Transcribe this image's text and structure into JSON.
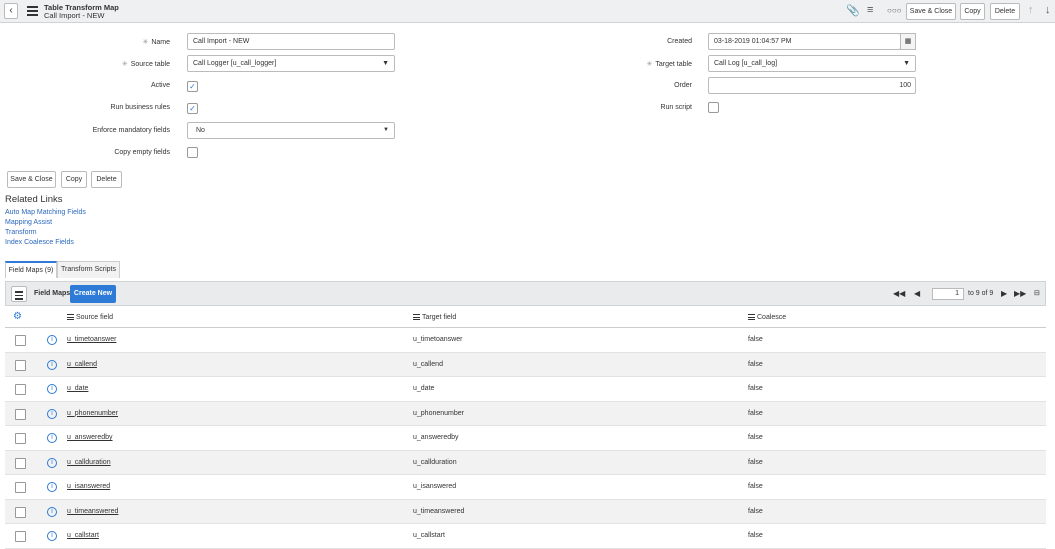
{
  "header": {
    "title": "Table Transform Map",
    "subtitle": "Call Import - NEW",
    "back_glyph": "‹",
    "buttons": {
      "save_close": "Save & Close",
      "copy": "Copy",
      "delete": "Delete"
    }
  },
  "form": {
    "name_label": "Name",
    "name_value": "Call Import - NEW",
    "source_table_label": "Source table",
    "source_table_value": "Call Logger [u_call_logger]",
    "active_label": "Active",
    "run_business_rules_label": "Run business rules",
    "enforce_label": "Enforce mandatory fields",
    "enforce_value": "No",
    "copy_empty_label": "Copy empty fields",
    "created_label": "Created",
    "created_value": "03-18-2019 01:04:57 PM",
    "target_table_label": "Target table",
    "target_table_value": "Call Log [u_call_log]",
    "order_label": "Order",
    "order_value": "100",
    "run_script_label": "Run script",
    "buttons": {
      "save_close": "Save & Close",
      "copy": "Copy",
      "delete": "Delete"
    }
  },
  "related_links": {
    "title": "Related Links",
    "links": [
      "Auto Map Matching Fields",
      "Mapping Assist",
      "Transform",
      "Index Coalesce Fields"
    ]
  },
  "tabs": [
    "Field Maps (9)",
    "Transform Scripts"
  ],
  "list": {
    "title": "Field Maps",
    "create_new": "Create New",
    "page_value": "1",
    "page_total": "to 9 of 9",
    "columns": [
      "Source field",
      "Target field",
      "Coalesce"
    ],
    "rows": [
      [
        "u_timetoanswer",
        "u_timetoanswer",
        "false"
      ],
      [
        "u_callend",
        "u_callend",
        "false"
      ],
      [
        "u_date",
        "u_date",
        "false"
      ],
      [
        "u_phonenumber",
        "u_phonenumber",
        "false"
      ],
      [
        "u_answeredby",
        "u_answeredby",
        "false"
      ],
      [
        "u_callduration",
        "u_callduration",
        "false"
      ],
      [
        "u_isanswered",
        "u_isanswered",
        "false"
      ],
      [
        "u_timeanswered",
        "u_timeanswered",
        "false"
      ],
      [
        "u_callstart",
        "u_callstart",
        "false"
      ]
    ]
  }
}
